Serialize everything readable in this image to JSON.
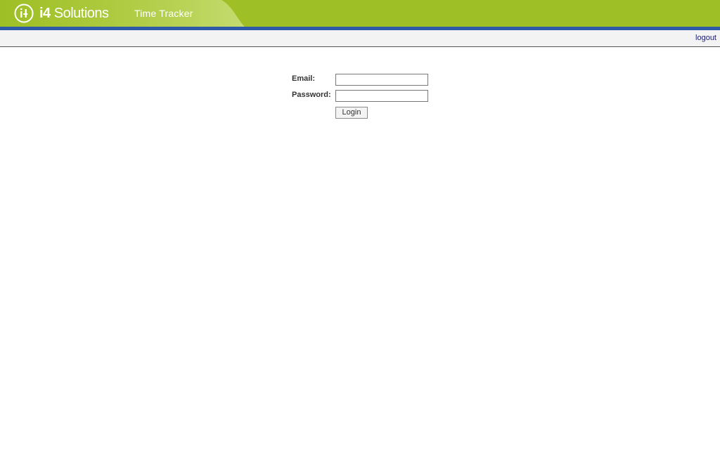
{
  "header": {
    "brand_prefix": "i4",
    "brand_rest": " Solutions",
    "app_name": "Time Tracker",
    "logo_icon": "i4-logo-icon",
    "colors": {
      "header_green": "#9ebf26",
      "accent_blue": "#2e5aa8"
    }
  },
  "subnav": {
    "logout_label": "logout"
  },
  "login": {
    "email_label": "Email:",
    "email_value": "",
    "password_label": "Password:",
    "password_value": "",
    "submit_label": "Login"
  }
}
